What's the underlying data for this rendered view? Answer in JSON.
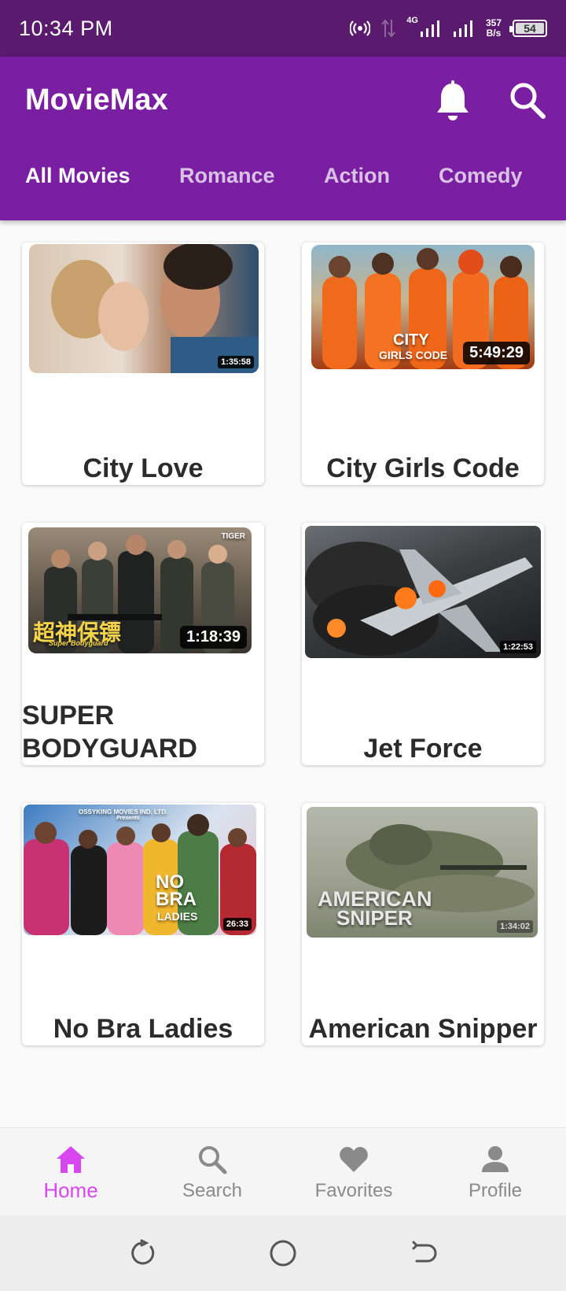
{
  "status": {
    "time": "10:34 PM",
    "network": "4G",
    "speed_value": "357",
    "speed_unit": "B/s",
    "battery": "54"
  },
  "app": {
    "title": "MovieMax"
  },
  "tabs": [
    {
      "label": "All Movies"
    },
    {
      "label": "Romance"
    },
    {
      "label": "Action"
    },
    {
      "label": "Comedy"
    }
  ],
  "movies": [
    {
      "title": "City Love",
      "duration": "1:35:58"
    },
    {
      "title": "City Girls Code",
      "duration": "5:49:29",
      "thumb_text": [
        "CITY",
        "GIRLS CODE"
      ]
    },
    {
      "title": "SUPER BODYGUARD",
      "duration": "1:18:39",
      "thumb_text": [
        "TIGER",
        "超神保镖",
        "Super Bodyguard"
      ]
    },
    {
      "title": "Jet Force",
      "duration": "1:22:53"
    },
    {
      "title": "No Bra Ladies",
      "duration": "26:33",
      "thumb_text": [
        "OSSYKING MOVIES IND. LTD.",
        "Presents",
        "NO",
        "BRA",
        "LADIES"
      ]
    },
    {
      "title": "American Snipper",
      "duration": "1:34:02",
      "thumb_text": [
        "AMERICAN",
        "SNIPER"
      ]
    }
  ],
  "bottom_nav": [
    {
      "label": "Home",
      "icon": "home-icon",
      "active": true
    },
    {
      "label": "Search",
      "icon": "search-icon"
    },
    {
      "label": "Favorites",
      "icon": "heart-icon"
    },
    {
      "label": "Profile",
      "icon": "person-icon"
    }
  ],
  "colors": {
    "status_bar": "#5a1a6e",
    "app_bar": "#7b1fa2",
    "active_nav": "#d846ef"
  }
}
